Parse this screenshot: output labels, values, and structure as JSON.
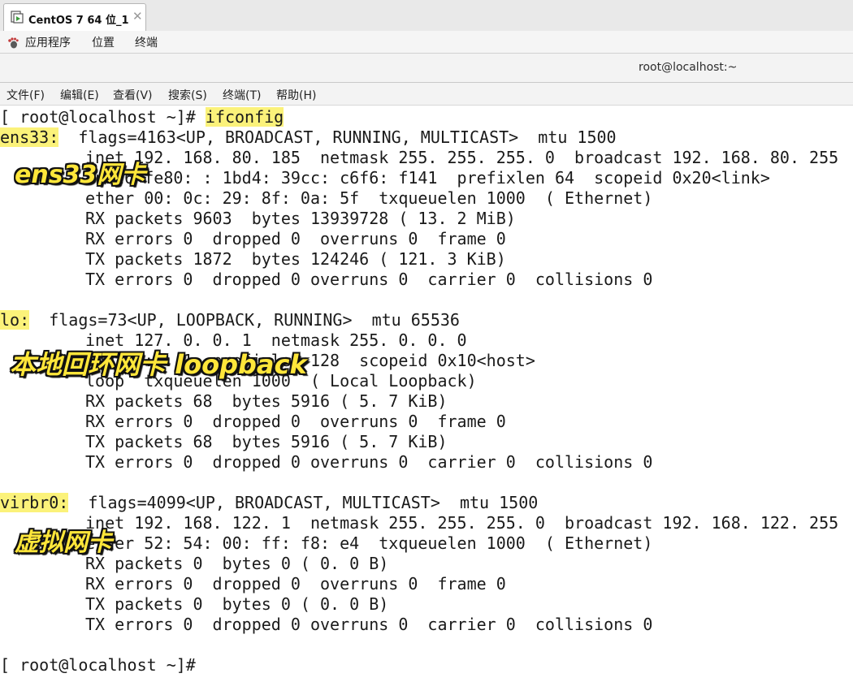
{
  "vm_tab": {
    "title": "CentOS 7 64 位_1",
    "close_glyph": "✕",
    "icon": "vm-icon"
  },
  "gnome_bar": {
    "apps_icon": "gnome-foot-icon",
    "menus": [
      "应用程序",
      "位置",
      "终端"
    ]
  },
  "window": {
    "title": "root@localhost:~"
  },
  "menubar": {
    "items": [
      "文件(F)",
      "编辑(E)",
      "查看(V)",
      "搜索(S)",
      "终端(T)",
      "帮助(H)"
    ]
  },
  "colors": {
    "highlight": "#fbf27a",
    "caption_fill": "#ffe63a",
    "caption_outline": "#111111"
  },
  "terminal": {
    "prompt": "[ root@localhost ~]# ",
    "command": "ifconfig",
    "interfaces": [
      {
        "name": "ens33:",
        "flags": "flags=4163<UP, BROADCAST, RUNNING, MULTICAST>  mtu 1500",
        "lines": [
          "inet 192. 168. 80. 185  netmask 255. 255. 255. 0  broadcast 192. 168. 80. 255",
          "inet6 fe80: : 1bd4: 39cc: c6f6: f141  prefixlen 64  scopeid 0x20<link>",
          "ether 00: 0c: 29: 8f: 0a: 5f  txqueuelen 1000  ( Ethernet)",
          "RX packets 9603  bytes 13939728 ( 13. 2 MiB)",
          "RX errors 0  dropped 0  overruns 0  frame 0",
          "TX packets 1872  bytes 124246 ( 121. 3 KiB)",
          "TX errors 0  dropped 0 overruns 0  carrier 0  collisions 0"
        ]
      },
      {
        "name": "lo:",
        "flags": "flags=73<UP, LOOPBACK, RUNNING>  mtu 65536",
        "lines": [
          "inet 127. 0. 0. 1  netmask 255. 0. 0. 0",
          "inet6 : : 1  prefixlen 128  scopeid 0x10<host>",
          "loop  txqueuelen 1000  ( Local Loopback)",
          "RX packets 68  bytes 5916 ( 5. 7 KiB)",
          "RX errors 0  dropped 0  overruns 0  frame 0",
          "TX packets 68  bytes 5916 ( 5. 7 KiB)",
          "TX errors 0  dropped 0 overruns 0  carrier 0  collisions 0"
        ]
      },
      {
        "name": "virbr0:",
        "flags": "flags=4099<UP, BROADCAST, MULTICAST>  mtu 1500",
        "lines": [
          "inet 192. 168. 122. 1  netmask 255. 255. 255. 0  broadcast 192. 168. 122. 255",
          "ether 52: 54: 00: ff: f8: e4  txqueuelen 1000  ( Ethernet)",
          "RX packets 0  bytes 0 ( 0. 0 B)",
          "RX errors 0  dropped 0  overruns 0  frame 0",
          "TX packets 0  bytes 0 ( 0. 0 B)",
          "TX errors 0  dropped 0 overruns 0  carrier 0  collisions 0"
        ]
      }
    ],
    "final_prompt": "[ root@localhost ~]#"
  },
  "captions": {
    "ens33": "ens33网卡",
    "loopback": "本地回环网卡 loopback",
    "virbr0": "虚拟网卡"
  }
}
